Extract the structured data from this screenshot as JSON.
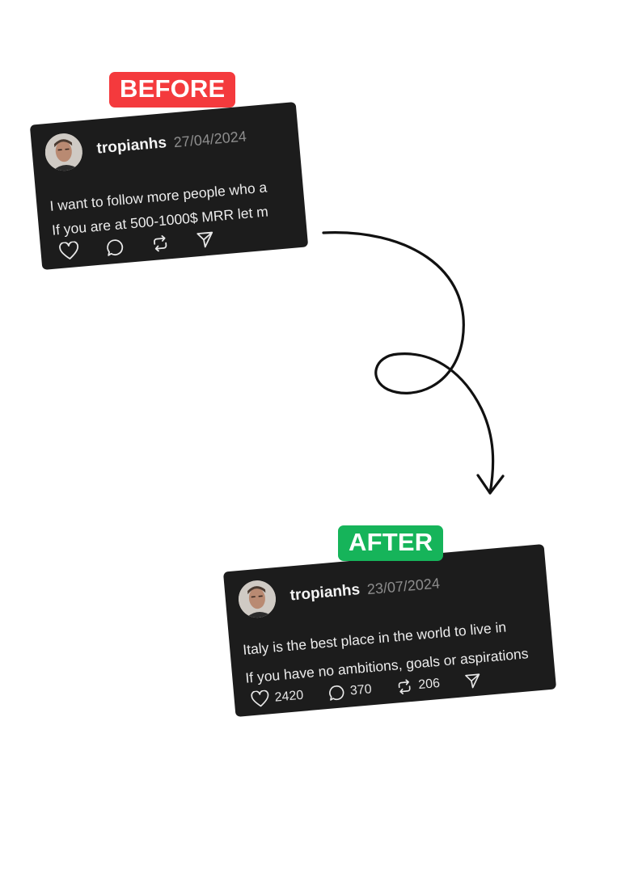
{
  "before": {
    "badge": "BEFORE",
    "username": "tropianhs",
    "date": "27/04/2024",
    "line1": "I want to follow more people who a",
    "line2": "If you are at 500-1000$ MRR let m"
  },
  "after": {
    "badge": "AFTER",
    "username": "tropianhs",
    "date": "23/07/2024",
    "line1": "Italy is the best place in the world to live in",
    "line2": "If you have no ambitions, goals or aspirations",
    "likes": "2420",
    "comments": "370",
    "reposts": "206"
  },
  "colors": {
    "before_badge": "#f43a3d",
    "after_badge": "#16b45a",
    "card_bg": "#1c1c1c"
  },
  "icons": [
    "heart-icon",
    "comment-icon",
    "repost-icon",
    "send-icon"
  ]
}
